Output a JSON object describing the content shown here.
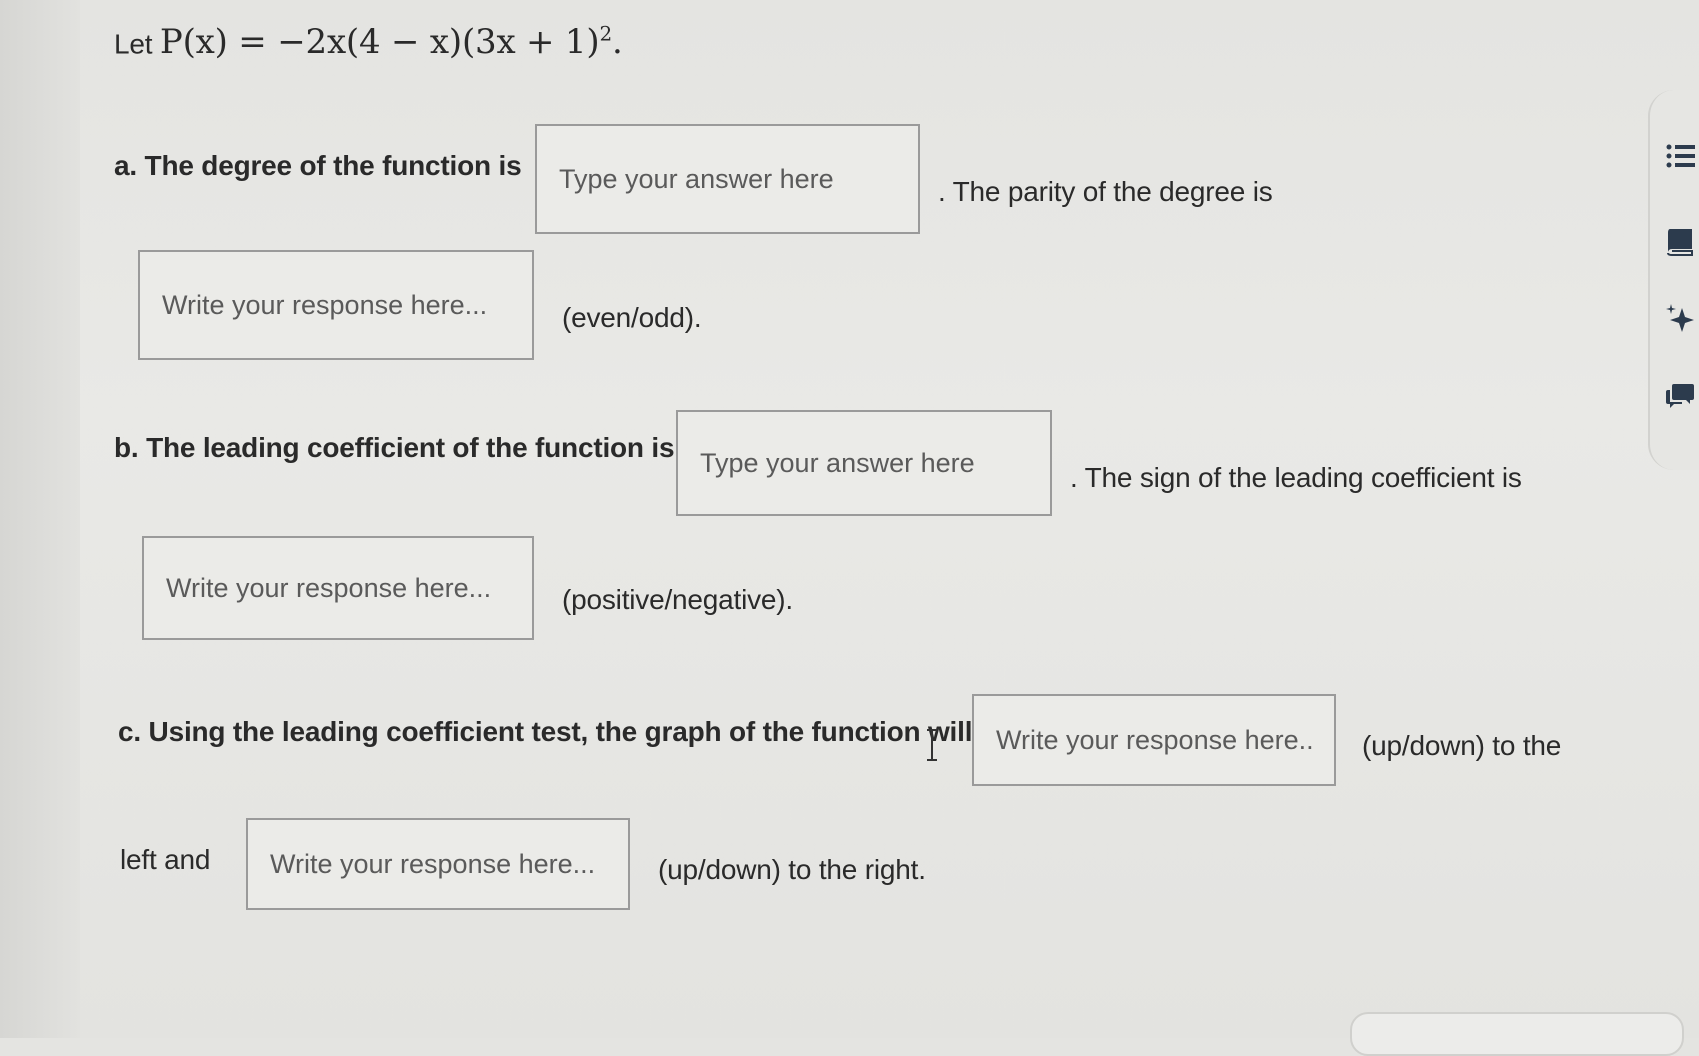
{
  "question": {
    "intro_let": "Let",
    "function_lhs": "P(x) = ",
    "function_rhs": "−2x(4 − x)(3x + 1)",
    "function_exp": "2",
    "function_end": "."
  },
  "part_a": {
    "label": "a.",
    "text1": "The degree of the function is",
    "degree_placeholder": "Type your answer here",
    "text2": ". The parity of the degree is",
    "parity_placeholder": "Write your response here...",
    "text3": "(even/odd)."
  },
  "part_b": {
    "label": "b.",
    "text1": "The leading coefficient of the function is",
    "coef_placeholder": "Type your answer here",
    "text2": ". The sign of the leading coefficient is",
    "sign_placeholder": "Write your response here...",
    "text3": "(positive/negative)."
  },
  "part_c": {
    "label": "c.",
    "text1": "Using the leading coefficient test, the graph of the function will go",
    "left_placeholder": "Write your response here...",
    "text2": "(up/down) to the",
    "text3": "left and",
    "right_placeholder": "Write your response here...",
    "text4": "(up/down) to the right."
  },
  "sidebar": {
    "icons": [
      "list-icon",
      "book-icon",
      "sparkle-icon",
      "chat-icon"
    ]
  },
  "colors": {
    "background": "#e6e6e3",
    "box_border": "#9a9a9a",
    "text": "#2a2a2a",
    "icon": "#2c3b4d"
  }
}
